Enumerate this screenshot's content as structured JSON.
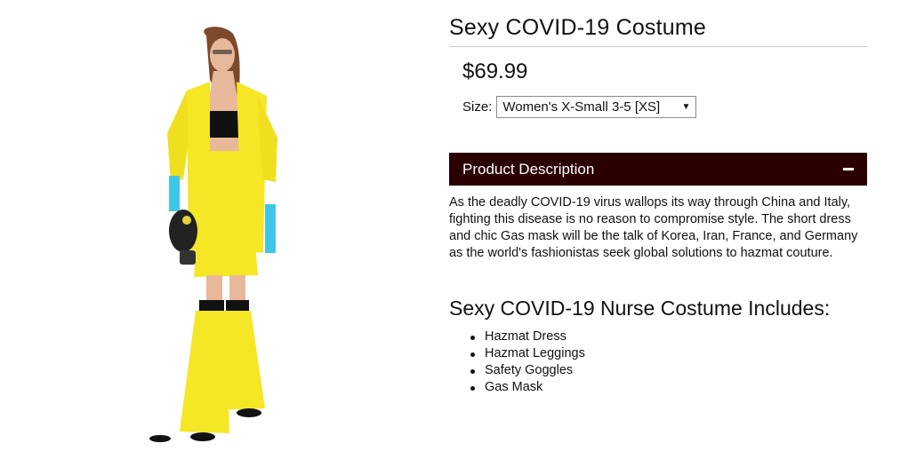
{
  "product": {
    "title": "Sexy COVID-19 Costume",
    "price": "$69.99",
    "size_label": "Size:",
    "size_selected": "Women's X-Small 3-5 [XS]"
  },
  "description": {
    "header": "Product Description",
    "text": "As the deadly COVID-19 virus wallops its way through China and Italy, fighting this disease is no reason to compromise style. The short dress and chic Gas mask will be the talk of Korea, Iran, France, and Germany as the world's fashionistas seek global solutions to hazmat couture."
  },
  "includes": {
    "heading": "Sexy COVID-19 Nurse Costume Includes:",
    "items": [
      "Hazmat Dress",
      "Hazmat Leggings",
      "Safety Goggles",
      "Gas Mask"
    ]
  },
  "colors": {
    "accent_bar": "#2b0000",
    "costume_yellow": "#f5e626",
    "gloves_blue": "#3fc6e6"
  }
}
